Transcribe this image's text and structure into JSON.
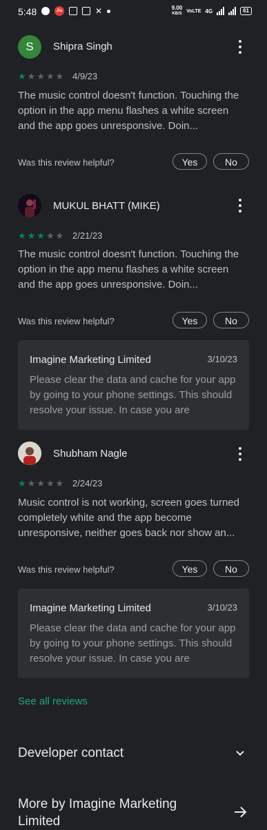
{
  "status_bar": {
    "time": "5:48",
    "speed": "9.00",
    "speed_unit": "KB/S",
    "network": "4G",
    "battery": "61",
    "jio_label": "Jio"
  },
  "reviews": [
    {
      "avatar_letter": "S",
      "name": "Shipra Singh",
      "rating": 1,
      "date": "4/9/23",
      "text": "The music control doesn't function. Touching the option in the app menu flashes a white screen and the app goes unresponsive. Doin...",
      "helpful_prompt": "Was this review helpful?",
      "yes_label": "Yes",
      "no_label": "No"
    },
    {
      "name": "MUKUL BHATT (MIKE)",
      "rating": 3,
      "date": "2/21/23",
      "text": "The music control doesn't function. Touching the option in the app menu flashes a white screen and the app goes unresponsive. Doin...",
      "helpful_prompt": "Was this review helpful?",
      "yes_label": "Yes",
      "no_label": "No",
      "reply": {
        "developer": "Imagine Marketing Limited",
        "date": "3/10/23",
        "text": "Please clear the data and cache for your app by going to your phone settings. This should resolve your issue. In case you are"
      }
    },
    {
      "name": "Shubham Nagle",
      "rating": 1,
      "date": "2/24/23",
      "text": "Music control is not working, screen goes turned completely white and the app become unresponsive, neither goes back nor show an...",
      "helpful_prompt": "Was this review helpful?",
      "yes_label": "Yes",
      "no_label": "No",
      "reply": {
        "developer": "Imagine Marketing Limited",
        "date": "3/10/23",
        "text": "Please clear the data and cache for your app by going to your phone settings. This should resolve your issue. In case you are"
      }
    }
  ],
  "see_all_label": "See all reviews",
  "developer_contact_label": "Developer contact",
  "more_by_label": "More by Imagine Marketing Limited",
  "colors": {
    "background": "#202124",
    "star_on": "#01875f",
    "star_off": "#5f6368",
    "link": "#1fa776"
  }
}
